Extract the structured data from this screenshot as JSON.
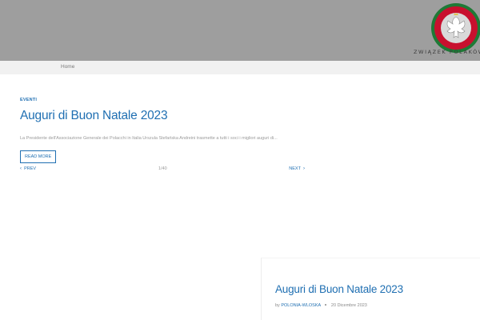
{
  "header": {
    "logo_text": "ZWIĄZEK POLAKÓW",
    "seal_colors": {
      "outer": "#1e7a36",
      "ring": "#c8102e",
      "inner": "#ffffff"
    }
  },
  "breadcrumb": {
    "home": "Home"
  },
  "slider": {
    "category": "EVENTI",
    "title": "Auguri di Buon Natale 2023",
    "excerpt": "La Presidente dell'Associazione Generale dei Polacchi in Italia Urszula Stefańska Andreini trasmette a tutti i soci i migliori auguri di...",
    "read_more": "READ MORE",
    "prev": "PREV",
    "next": "NEXT",
    "counter": "1/40"
  },
  "post": {
    "title": "Auguri di Buon Natale 2023",
    "by": "by",
    "author": "POLONIA-WLOSKA",
    "date": "20 Dicembre 2023"
  },
  "colors": {
    "accent": "#1f6fb2",
    "header_bg": "#9e9e9e",
    "breadcrumb_bg": "#f1f1f1"
  }
}
